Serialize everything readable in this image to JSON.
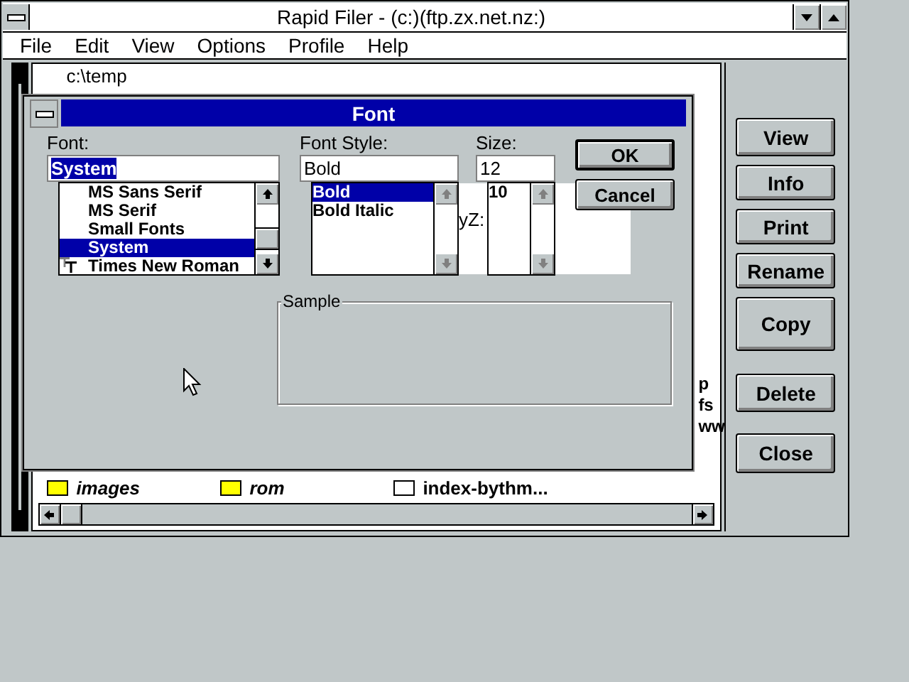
{
  "main_window": {
    "title": "Rapid Filer - (c:)(ftp.zx.net.nz:)",
    "menu": [
      "File",
      "Edit",
      "View",
      "Options",
      "Profile",
      "Help"
    ],
    "path": "c:\\temp",
    "fragments": [
      "p",
      "fs",
      "ww"
    ],
    "files": [
      {
        "name": "images",
        "kind": "folder"
      },
      {
        "name": "rom",
        "kind": "folder"
      },
      {
        "name": "index-bythm...",
        "kind": "file"
      }
    ],
    "buttons": [
      "View",
      "Info",
      "Print",
      "Rename",
      "Copy",
      "Delete",
      "Close"
    ]
  },
  "dialog": {
    "title": "Font",
    "font": {
      "label": "Font:",
      "value": "System",
      "items": [
        {
          "name": "MS Sans Serif",
          "truetype": false,
          "selected": false
        },
        {
          "name": "MS Serif",
          "truetype": false,
          "selected": false
        },
        {
          "name": "Small Fonts",
          "truetype": false,
          "selected": false
        },
        {
          "name": "System",
          "truetype": false,
          "selected": true
        },
        {
          "name": "Times New Roman",
          "truetype": true,
          "selected": false
        }
      ]
    },
    "style": {
      "label": "Font Style:",
      "value": "Bold",
      "items": [
        {
          "name": "Bold",
          "selected": true
        },
        {
          "name": "Bold Italic",
          "selected": false
        }
      ]
    },
    "size": {
      "label": "Size:",
      "value": "12",
      "items": [
        {
          "name": "10",
          "selected": false
        }
      ]
    },
    "stray_text": "yZ:",
    "buttons": [
      {
        "label": "OK",
        "default": true
      },
      {
        "label": "Cancel",
        "default": false
      }
    ],
    "sample": {
      "label": "Sample"
    }
  }
}
